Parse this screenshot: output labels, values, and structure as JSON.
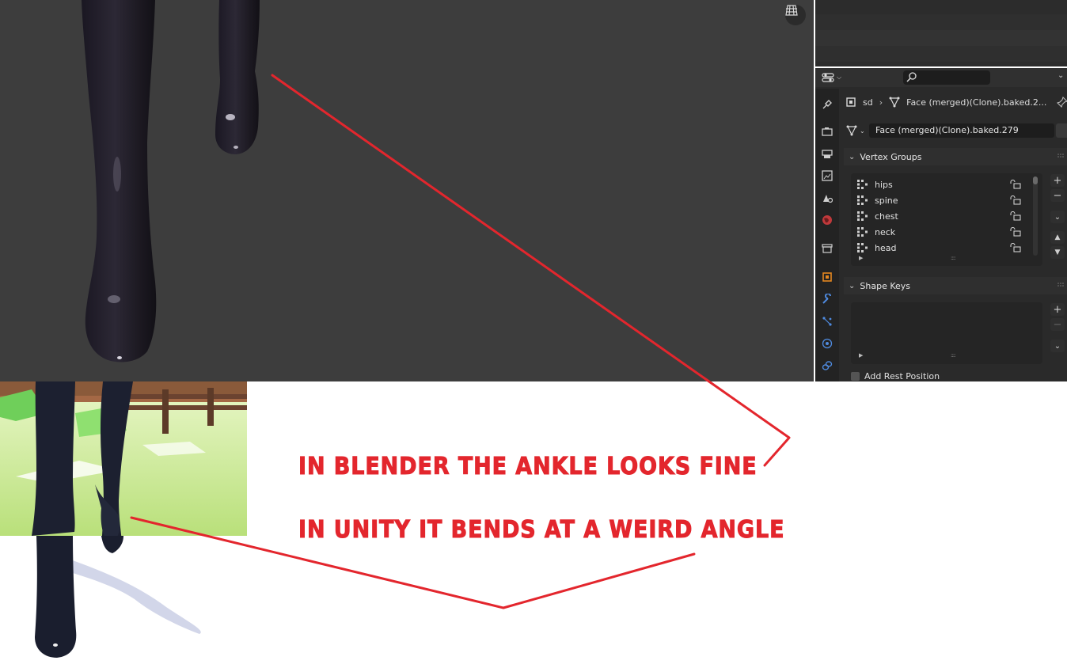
{
  "properties": {
    "breadcrumb": {
      "collection": "sd",
      "object": "Face (merged)(Clone).baked.2..."
    },
    "mesh_data_name": "Face (merged)(Clone).baked.279",
    "vertex_groups": {
      "title": "Vertex Groups",
      "items": [
        "hips",
        "spine",
        "chest",
        "neck",
        "head"
      ]
    },
    "shape_keys": {
      "title": "Shape Keys"
    },
    "add_rest_position": {
      "label": "Add Rest Position",
      "checked": false
    }
  },
  "annotations": {
    "caption_blender": "In Blender the ankle looks fine",
    "caption_unity": "In Unity it bends at a weird angle",
    "line_color": "#e3262d"
  },
  "colors": {
    "viewport_bg": "#3d3d3d",
    "panel_bg": "#2a2a2a",
    "accent_orange": "#e5871f",
    "accent_blue": "#4f8be0"
  }
}
